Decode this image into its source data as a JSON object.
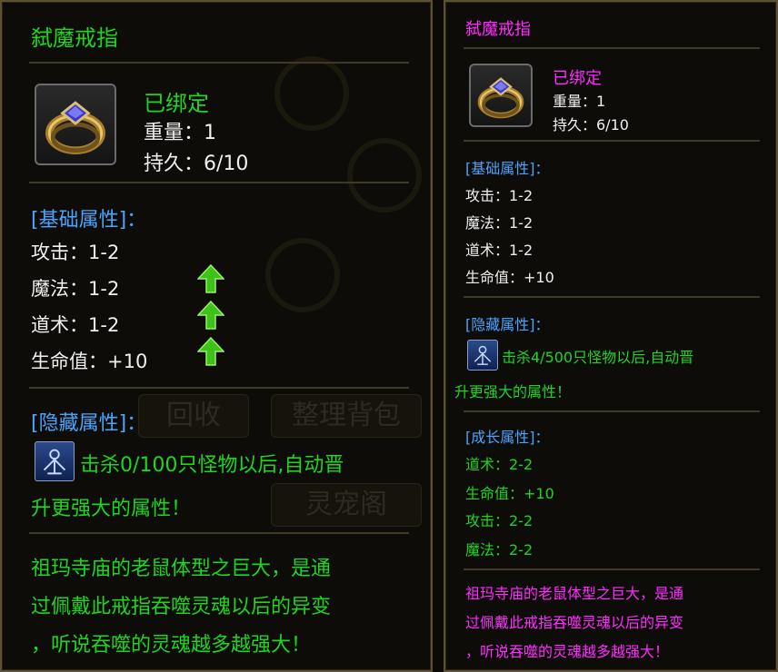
{
  "left_tooltip": {
    "title": "弑魔戒指",
    "bound": "已绑定",
    "weight": "重量：1",
    "durability": "持久：6/10",
    "base_header": "[基础属性]：",
    "base_stats": [
      "攻击：1-2",
      "魔法：1-2",
      "道术：1-2",
      "生命值：+10"
    ],
    "hidden_header": "[隐藏属性]：",
    "hidden_line1": "击杀0/100只怪物以后,自动晋",
    "hidden_line2": "升更强大的属性！",
    "desc_line1": "祖玛寺庙的老鼠体型之巨大，是通",
    "desc_line2": "过佩戴此戒指吞噬灵魂以后的异变",
    "desc_line3": "，听说吞噬的灵魂越多越强大！",
    "background_buttons": [
      "回收",
      "整理背包",
      "灵宠阁"
    ]
  },
  "right_tooltip": {
    "title": "弑魔戒指",
    "bound": "已绑定",
    "weight": "重量：1",
    "durability": "持久：6/10",
    "base_header": "[基础属性]：",
    "base_stats": [
      "攻击：1-2",
      "魔法：1-2",
      "道术：1-2",
      "生命值：+10"
    ],
    "hidden_header": "[隐藏属性]：",
    "hidden_line1": "击杀4/500只怪物以后,自动晋",
    "hidden_line2": "升更强大的属性！",
    "growth_header": "[成长属性]：",
    "growth_stats": [
      "道术：2-2",
      "生命值：+10",
      "攻击：2-2",
      "魔法：2-2"
    ],
    "desc_line1": "祖玛寺庙的老鼠体型之巨大，是通",
    "desc_line2": "过佩戴此戒指吞噬灵魂以后的异变",
    "desc_line3": "，听说吞噬的灵魂越多越强大！"
  },
  "colors": {
    "title_left": "#1fd51f",
    "title_right": "#ff2cff",
    "header": "#4aa4ff",
    "stat": "#efefef",
    "hidden_text": "#1fd51f",
    "growth": "#1fd51f",
    "desc_left": "#1fd51f",
    "desc_right": "#ff2cff",
    "upgrade_arrow": "#3ec21a"
  },
  "icons": {
    "item": "gold-ring-with-sapphire-icon",
    "hidden_skill": "blue-rune-icon",
    "upgrade": "green-up-arrow-icon"
  }
}
